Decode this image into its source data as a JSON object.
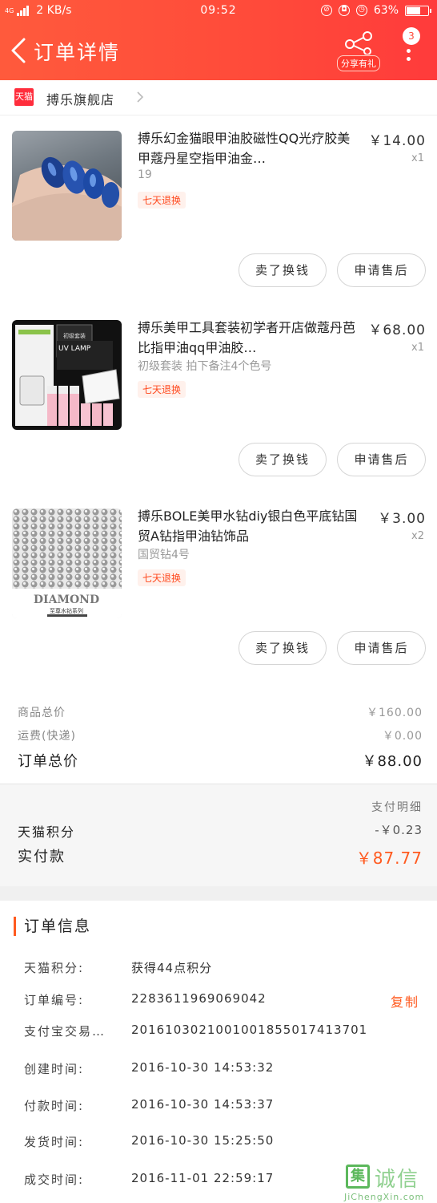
{
  "status_bar": {
    "network": "4G",
    "speed": "2 KB/s",
    "time": "09:52",
    "battery": "63%"
  },
  "header": {
    "title": "订单详情",
    "share_label": "分享有礼",
    "more_badge": "3"
  },
  "store": {
    "badge": "天猫",
    "name": "搏乐旗舰店"
  },
  "items": [
    {
      "title": "搏乐幻金猫眼甲油胶磁性QQ光疗胶美甲蔻丹星空指甲油金…",
      "price": "￥14.00",
      "qty": "x1",
      "spec": "19",
      "tag": "七天退换",
      "btn_sell": "卖了换钱",
      "btn_after": "申请售后",
      "thumb_icon": "blue-cat-eye-nails-photo"
    },
    {
      "title": "搏乐美甲工具套装初学者开店做蔻丹芭比指甲油qq甲油胶…",
      "price": "￥68.00",
      "qty": "x1",
      "spec": "初级套装 拍下备注4个色号",
      "tag": "七天退换",
      "btn_sell": "卖了换钱",
      "btn_after": "申请售后",
      "thumb_icon": "uv-lamp-kit-photo",
      "thumb_text": "UV LAMP",
      "thumb_box_text": "初级套装"
    },
    {
      "title": "搏乐BOLE美甲水钻diy银白色平底钻国贸A钻指甲油钻饰品",
      "price": "￥3.00",
      "qty": "x2",
      "spec": "国贸钻4号",
      "tag": "七天退换",
      "btn_sell": "卖了换钱",
      "btn_after": "申请售后",
      "thumb_icon": "rhinestones-photo",
      "thumb_text": "DIAMOND",
      "thumb_sub": "至尊水钻系列"
    }
  ],
  "summary": {
    "goods_label": "商品总价",
    "goods_value": "￥160.00",
    "shipping_label": "运费(快递)",
    "shipping_value": "￥0.00",
    "total_label": "订单总价",
    "total_value": "￥88.00"
  },
  "payment": {
    "detail_label": "支付明细",
    "points_label": "天猫积分",
    "points_value": "-￥0.23",
    "actual_label": "实付款",
    "actual_value": "￥87.77"
  },
  "order_info": {
    "heading": "订单信息",
    "rows": [
      {
        "label": "天猫积分:",
        "value": "获得44点积分"
      },
      {
        "label": "订单编号:",
        "value": "2283611969069042"
      },
      {
        "label": "支付宝交易…",
        "value": "2016103021001001855017413701"
      },
      {
        "label": "创建时间:",
        "value": "2016-10-30 14:53:32"
      },
      {
        "label": "付款时间:",
        "value": "2016-10-30 14:53:37"
      },
      {
        "label": "发货时间:",
        "value": "2016-10-30 15:25:50"
      },
      {
        "label": "成交时间:",
        "value": "2016-11-01 22:59:17"
      }
    ],
    "copy_label": "复制"
  },
  "watermark": {
    "char": "集",
    "text": "诚信",
    "url": "JiChengXin.com"
  },
  "colors": {
    "header_red": "#ff4a3a",
    "accent_orange": "#ff5a1f",
    "tag_bg": "#fff1ec"
  }
}
